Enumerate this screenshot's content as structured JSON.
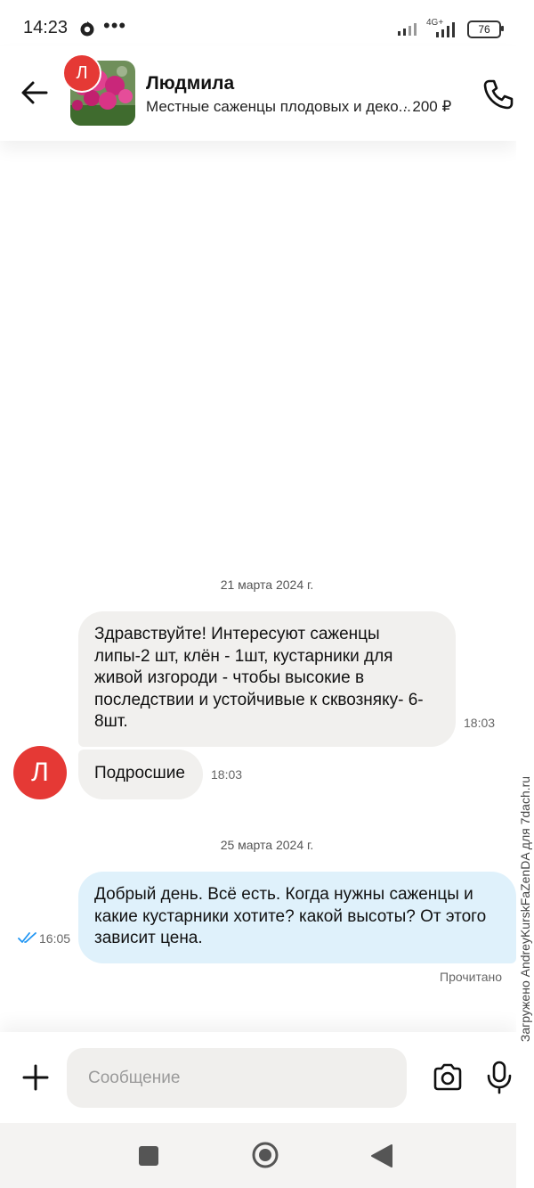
{
  "status_bar": {
    "time": "14:23",
    "dots": "•••",
    "network": "4G+",
    "battery": "76"
  },
  "header": {
    "avatar_letter": "Л",
    "name": "Людмила",
    "listing_title": "Местные саженцы плодовых и деко...",
    "price": "· 200 ₽"
  },
  "messages": [
    {
      "date": "21 марта 2024 г.",
      "direction": "incoming",
      "text": "Здравствуйте! Интересуют саженцы липы-2 шт,  клён - 1шт,  кустарники для живой изгороди - чтобы высокие в последствии  и устойчивые к сквозняку- 6-8шт.",
      "time": "18:03"
    },
    {
      "direction": "incoming",
      "text": "Подросшие",
      "time": "18:03",
      "avatar_letter": "Л"
    },
    {
      "date": "25 марта 2024 г.",
      "direction": "outgoing",
      "text": "Добрый день. Всё есть. Когда нужны саженцы и какие кустарники хотите? какой высоты? От этого зависит цена.",
      "time": "16:05",
      "status": "Прочитано"
    }
  ],
  "composer": {
    "placeholder": "Сообщение"
  },
  "watermark": "Загружено AndreyKurskFaZenDA для 7dach.ru",
  "colors": {
    "accent_red": "#e53935",
    "incoming_bubble": "#f1f0ee",
    "outgoing_bubble": "#dff1fb",
    "read_check": "#2196f3"
  }
}
